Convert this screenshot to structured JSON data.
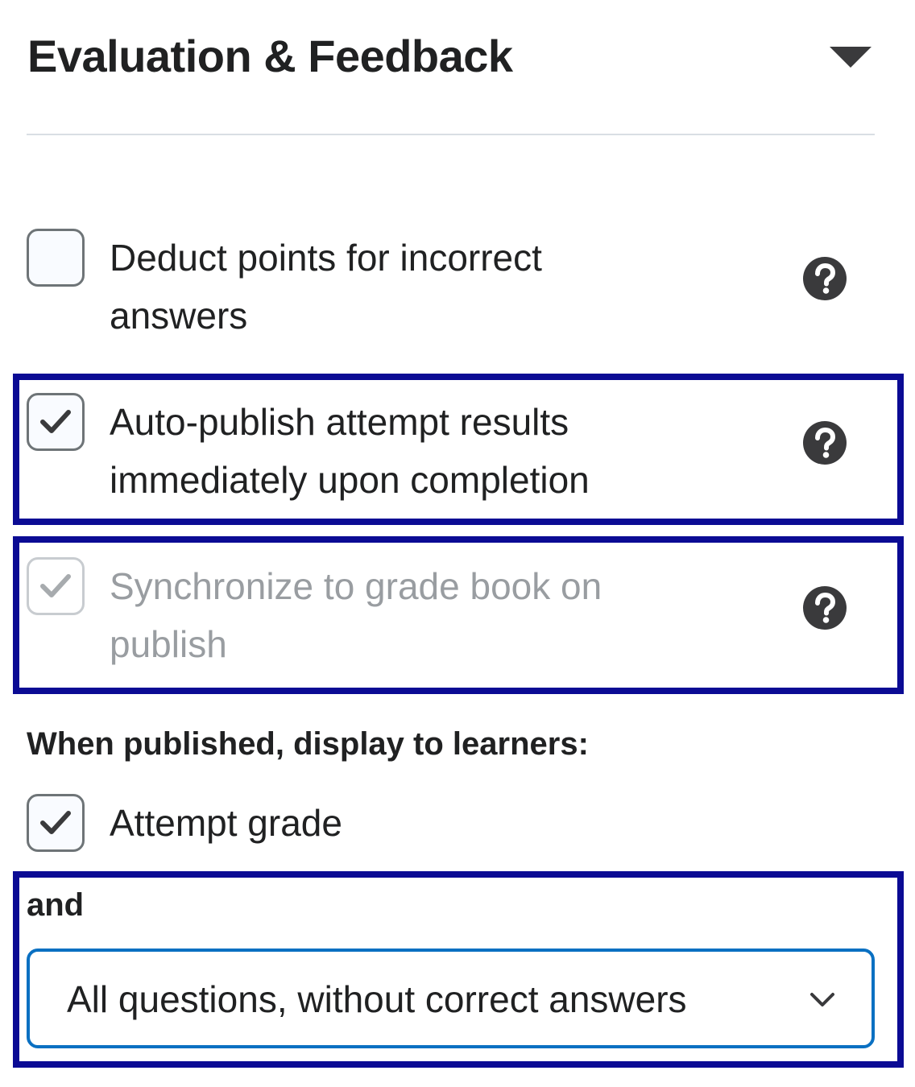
{
  "section": {
    "title": "Evaluation & Feedback",
    "toggle_icon": "caret-down-icon"
  },
  "options": [
    {
      "label": "Deduct points for incorrect answers",
      "checked": false,
      "disabled": false,
      "help_icon": "help-icon"
    },
    {
      "label": "Auto-publish attempt results immediately upon completion",
      "checked": true,
      "disabled": false,
      "help_icon": "help-icon"
    },
    {
      "label": "Synchronize to grade book on publish",
      "checked": true,
      "disabled": true,
      "help_icon": "help-icon"
    }
  ],
  "display": {
    "heading": "When published, display to learners:",
    "attempt_grade": {
      "label": "Attempt grade",
      "checked": true
    },
    "and_label": "and",
    "questions_select": {
      "value": "All questions, without correct answers",
      "icon": "chevron-down-icon"
    }
  },
  "colors": {
    "highlight_border": "#0b0b94",
    "select_border": "#0a70c2",
    "help_icon": "#3a3a3c",
    "disabled_text": "#999da1"
  }
}
